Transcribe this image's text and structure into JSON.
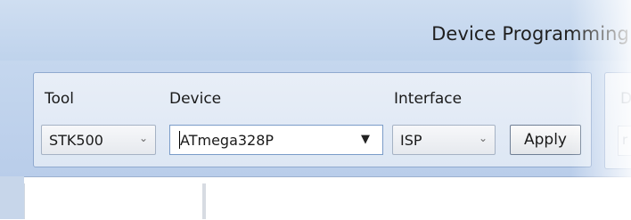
{
  "window": {
    "title": "Device Programming"
  },
  "toolbar": {
    "tool": {
      "label": "Tool",
      "value": "STK500"
    },
    "device": {
      "label": "Device",
      "value": "ATmega328P"
    },
    "interface": {
      "label": "Interface",
      "value": "ISP"
    },
    "apply_label": "Apply",
    "next_group_label_clipped": "D",
    "next_group_value_clipped": "r"
  }
}
